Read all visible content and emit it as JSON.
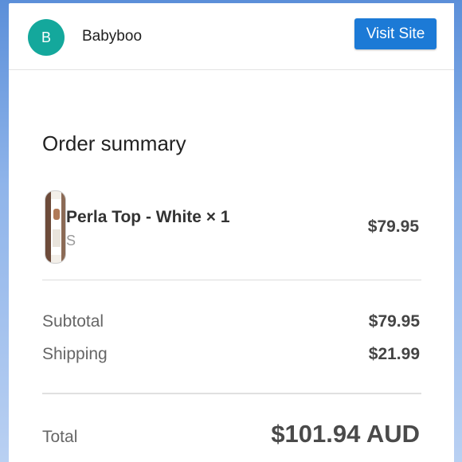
{
  "header": {
    "avatar_letter": "B",
    "brand_name": "Babyboo",
    "visit_site_label": "Visit Site",
    "avatar_color": "#14a89c",
    "button_color": "#1c7ad6"
  },
  "order_summary": {
    "title": "Order summary",
    "items": [
      {
        "name": "Perla Top - White × 1",
        "variant": "S",
        "price": "$79.95",
        "thumbnail": "product-image"
      }
    ],
    "subtotal_label": "Subtotal",
    "subtotal_value": "$79.95",
    "shipping_label": "Shipping",
    "shipping_value": "$21.99",
    "total_label": "Total",
    "total_value": "$101.94 AUD"
  }
}
